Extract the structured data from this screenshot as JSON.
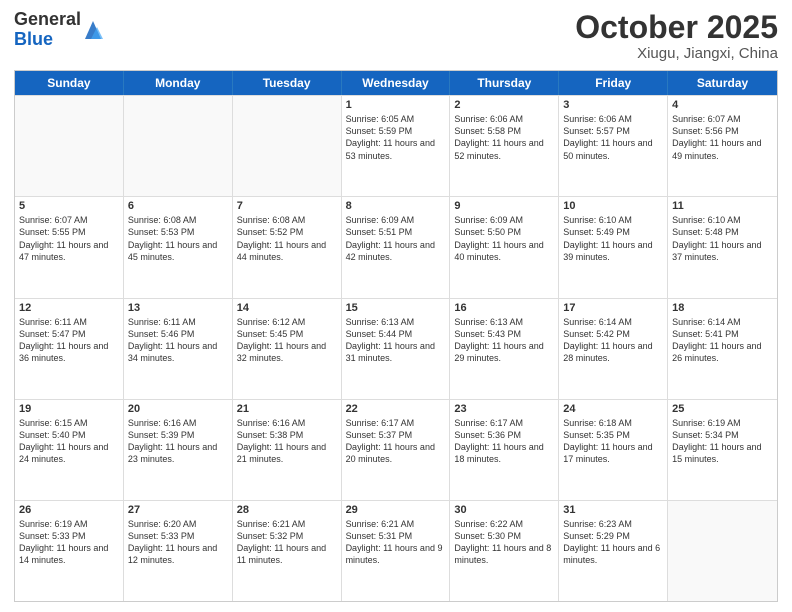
{
  "header": {
    "logo_general": "General",
    "logo_blue": "Blue",
    "title": "October 2025",
    "location": "Xiugu, Jiangxi, China"
  },
  "days_of_week": [
    "Sunday",
    "Monday",
    "Tuesday",
    "Wednesday",
    "Thursday",
    "Friday",
    "Saturday"
  ],
  "weeks": [
    [
      {
        "day": "",
        "sunrise": "",
        "sunset": "",
        "daylight": ""
      },
      {
        "day": "",
        "sunrise": "",
        "sunset": "",
        "daylight": ""
      },
      {
        "day": "",
        "sunrise": "",
        "sunset": "",
        "daylight": ""
      },
      {
        "day": "1",
        "sunrise": "Sunrise: 6:05 AM",
        "sunset": "Sunset: 5:59 PM",
        "daylight": "Daylight: 11 hours and 53 minutes."
      },
      {
        "day": "2",
        "sunrise": "Sunrise: 6:06 AM",
        "sunset": "Sunset: 5:58 PM",
        "daylight": "Daylight: 11 hours and 52 minutes."
      },
      {
        "day": "3",
        "sunrise": "Sunrise: 6:06 AM",
        "sunset": "Sunset: 5:57 PM",
        "daylight": "Daylight: 11 hours and 50 minutes."
      },
      {
        "day": "4",
        "sunrise": "Sunrise: 6:07 AM",
        "sunset": "Sunset: 5:56 PM",
        "daylight": "Daylight: 11 hours and 49 minutes."
      }
    ],
    [
      {
        "day": "5",
        "sunrise": "Sunrise: 6:07 AM",
        "sunset": "Sunset: 5:55 PM",
        "daylight": "Daylight: 11 hours and 47 minutes."
      },
      {
        "day": "6",
        "sunrise": "Sunrise: 6:08 AM",
        "sunset": "Sunset: 5:53 PM",
        "daylight": "Daylight: 11 hours and 45 minutes."
      },
      {
        "day": "7",
        "sunrise": "Sunrise: 6:08 AM",
        "sunset": "Sunset: 5:52 PM",
        "daylight": "Daylight: 11 hours and 44 minutes."
      },
      {
        "day": "8",
        "sunrise": "Sunrise: 6:09 AM",
        "sunset": "Sunset: 5:51 PM",
        "daylight": "Daylight: 11 hours and 42 minutes."
      },
      {
        "day": "9",
        "sunrise": "Sunrise: 6:09 AM",
        "sunset": "Sunset: 5:50 PM",
        "daylight": "Daylight: 11 hours and 40 minutes."
      },
      {
        "day": "10",
        "sunrise": "Sunrise: 6:10 AM",
        "sunset": "Sunset: 5:49 PM",
        "daylight": "Daylight: 11 hours and 39 minutes."
      },
      {
        "day": "11",
        "sunrise": "Sunrise: 6:10 AM",
        "sunset": "Sunset: 5:48 PM",
        "daylight": "Daylight: 11 hours and 37 minutes."
      }
    ],
    [
      {
        "day": "12",
        "sunrise": "Sunrise: 6:11 AM",
        "sunset": "Sunset: 5:47 PM",
        "daylight": "Daylight: 11 hours and 36 minutes."
      },
      {
        "day": "13",
        "sunrise": "Sunrise: 6:11 AM",
        "sunset": "Sunset: 5:46 PM",
        "daylight": "Daylight: 11 hours and 34 minutes."
      },
      {
        "day": "14",
        "sunrise": "Sunrise: 6:12 AM",
        "sunset": "Sunset: 5:45 PM",
        "daylight": "Daylight: 11 hours and 32 minutes."
      },
      {
        "day": "15",
        "sunrise": "Sunrise: 6:13 AM",
        "sunset": "Sunset: 5:44 PM",
        "daylight": "Daylight: 11 hours and 31 minutes."
      },
      {
        "day": "16",
        "sunrise": "Sunrise: 6:13 AM",
        "sunset": "Sunset: 5:43 PM",
        "daylight": "Daylight: 11 hours and 29 minutes."
      },
      {
        "day": "17",
        "sunrise": "Sunrise: 6:14 AM",
        "sunset": "Sunset: 5:42 PM",
        "daylight": "Daylight: 11 hours and 28 minutes."
      },
      {
        "day": "18",
        "sunrise": "Sunrise: 6:14 AM",
        "sunset": "Sunset: 5:41 PM",
        "daylight": "Daylight: 11 hours and 26 minutes."
      }
    ],
    [
      {
        "day": "19",
        "sunrise": "Sunrise: 6:15 AM",
        "sunset": "Sunset: 5:40 PM",
        "daylight": "Daylight: 11 hours and 24 minutes."
      },
      {
        "day": "20",
        "sunrise": "Sunrise: 6:16 AM",
        "sunset": "Sunset: 5:39 PM",
        "daylight": "Daylight: 11 hours and 23 minutes."
      },
      {
        "day": "21",
        "sunrise": "Sunrise: 6:16 AM",
        "sunset": "Sunset: 5:38 PM",
        "daylight": "Daylight: 11 hours and 21 minutes."
      },
      {
        "day": "22",
        "sunrise": "Sunrise: 6:17 AM",
        "sunset": "Sunset: 5:37 PM",
        "daylight": "Daylight: 11 hours and 20 minutes."
      },
      {
        "day": "23",
        "sunrise": "Sunrise: 6:17 AM",
        "sunset": "Sunset: 5:36 PM",
        "daylight": "Daylight: 11 hours and 18 minutes."
      },
      {
        "day": "24",
        "sunrise": "Sunrise: 6:18 AM",
        "sunset": "Sunset: 5:35 PM",
        "daylight": "Daylight: 11 hours and 17 minutes."
      },
      {
        "day": "25",
        "sunrise": "Sunrise: 6:19 AM",
        "sunset": "Sunset: 5:34 PM",
        "daylight": "Daylight: 11 hours and 15 minutes."
      }
    ],
    [
      {
        "day": "26",
        "sunrise": "Sunrise: 6:19 AM",
        "sunset": "Sunset: 5:33 PM",
        "daylight": "Daylight: 11 hours and 14 minutes."
      },
      {
        "day": "27",
        "sunrise": "Sunrise: 6:20 AM",
        "sunset": "Sunset: 5:33 PM",
        "daylight": "Daylight: 11 hours and 12 minutes."
      },
      {
        "day": "28",
        "sunrise": "Sunrise: 6:21 AM",
        "sunset": "Sunset: 5:32 PM",
        "daylight": "Daylight: 11 hours and 11 minutes."
      },
      {
        "day": "29",
        "sunrise": "Sunrise: 6:21 AM",
        "sunset": "Sunset: 5:31 PM",
        "daylight": "Daylight: 11 hours and 9 minutes."
      },
      {
        "day": "30",
        "sunrise": "Sunrise: 6:22 AM",
        "sunset": "Sunset: 5:30 PM",
        "daylight": "Daylight: 11 hours and 8 minutes."
      },
      {
        "day": "31",
        "sunrise": "Sunrise: 6:23 AM",
        "sunset": "Sunset: 5:29 PM",
        "daylight": "Daylight: 11 hours and 6 minutes."
      },
      {
        "day": "",
        "sunrise": "",
        "sunset": "",
        "daylight": ""
      }
    ]
  ]
}
